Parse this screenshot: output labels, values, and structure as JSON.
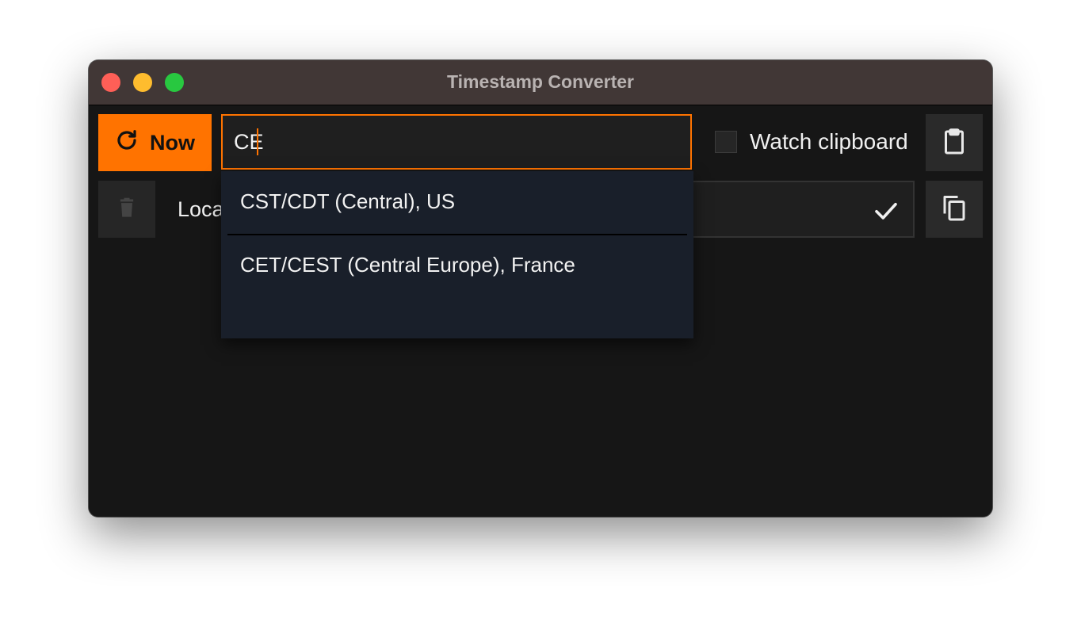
{
  "window": {
    "title": "Timestamp Converter"
  },
  "toolbar": {
    "now_label": "Now",
    "timezone_input_value": "CE",
    "watch_clipboard_label": "Watch clipboard",
    "watch_clipboard_checked": false
  },
  "rows": [
    {
      "label": "Loca",
      "value": ""
    }
  ],
  "dropdown": {
    "items": [
      {
        "label": "CST/CDT (Central), US"
      },
      {
        "label": "CET/CEST (Central Europe), France"
      }
    ]
  },
  "colors": {
    "accent": "#ff7300",
    "titlebar": "#413736",
    "background": "#161616",
    "dropdown_bg": "#191f2a"
  },
  "icons": {
    "now": "refresh-icon",
    "paste": "clipboard-icon",
    "delete": "trash-icon",
    "copy": "copy-icon",
    "confirm": "check-icon"
  }
}
